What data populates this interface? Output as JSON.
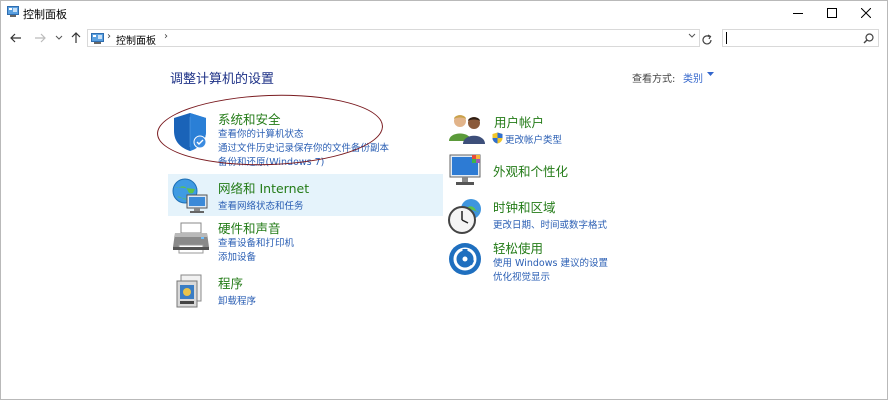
{
  "window": {
    "title": "控制面板"
  },
  "address": {
    "path_item": "控制面板",
    "separator": "›",
    "search_placeholder": ""
  },
  "content": {
    "heading": "调整计算机的设置",
    "view_by_label": "查看方式:",
    "view_by_value": "类别"
  },
  "categories_left": [
    {
      "title": "系统和安全",
      "links": [
        "查看你的计算机状态",
        "通过文件历史记录保存你的文件备份副本",
        "备份和还原(Windows 7)"
      ]
    },
    {
      "title": "网络和 Internet",
      "links": [
        "查看网络状态和任务"
      ]
    },
    {
      "title": "硬件和声音",
      "links": [
        "查看设备和打印机",
        "添加设备"
      ]
    },
    {
      "title": "程序",
      "links": [
        "卸载程序"
      ]
    }
  ],
  "categories_right": [
    {
      "title": "用户帐户",
      "links": [
        "更改帐户类型"
      ]
    },
    {
      "title": "外观和个性化",
      "links": []
    },
    {
      "title": "时钟和区域",
      "links": [
        "更改日期、时间或数字格式"
      ]
    },
    {
      "title": "轻松使用",
      "links": [
        "使用 Windows 建议的设置",
        "优化视觉显示"
      ]
    }
  ],
  "icons": {
    "title_icon": "control-panel-icon",
    "system_security": "shield-icon",
    "network": "globe-network-icon",
    "hardware": "printer-icon",
    "programs": "programs-icon",
    "user_accounts": "users-icon",
    "appearance": "monitor-icon",
    "clock": "clock-globe-icon",
    "ease": "ease-of-access-icon"
  },
  "colors": {
    "category_title": "#237b17",
    "link": "#2b5fb4",
    "heading": "#1e3287",
    "annotation": "#7a1b20"
  }
}
